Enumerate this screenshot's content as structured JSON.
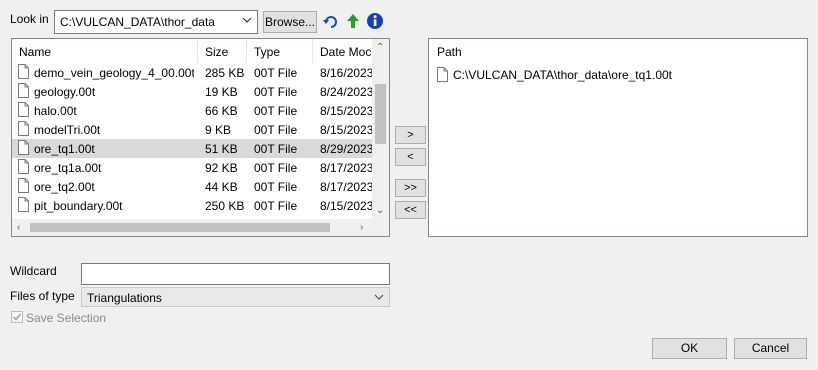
{
  "look_in": {
    "label": "Look in",
    "path": "C:\\VULCAN_DATA\\thor_data",
    "browse_label": "Browse..."
  },
  "icons": {
    "back": "back-arrow-icon",
    "up": "up-folder-icon",
    "info": "info-icon",
    "file": "file-icon",
    "dropdown": "chevron-down-icon"
  },
  "file_list": {
    "columns": [
      "Name",
      "Size",
      "Type",
      "Date Moc"
    ],
    "rows": [
      {
        "name": "demo_vein_geology_4_00.00t",
        "size": "285 KB",
        "type": "00T File",
        "date": "8/16/2023"
      },
      {
        "name": "geology.00t",
        "size": "19 KB",
        "type": "00T File",
        "date": "8/24/2023"
      },
      {
        "name": "halo.00t",
        "size": "66 KB",
        "type": "00T File",
        "date": "8/15/2023"
      },
      {
        "name": "modelTri.00t",
        "size": "9 KB",
        "type": "00T File",
        "date": "8/15/2023"
      },
      {
        "name": "ore_tq1.00t",
        "size": "51 KB",
        "type": "00T File",
        "date": "8/29/2023",
        "selected": true
      },
      {
        "name": "ore_tq1a.00t",
        "size": "92 KB",
        "type": "00T File",
        "date": "8/17/2023"
      },
      {
        "name": "ore_tq2.00t",
        "size": "44 KB",
        "type": "00T File",
        "date": "8/17/2023"
      },
      {
        "name": "pit_boundary.00t",
        "size": "250 KB",
        "type": "00T File",
        "date": "8/15/2023"
      }
    ]
  },
  "move_buttons": {
    "add": ">",
    "remove": "<",
    "add_all": ">>",
    "remove_all": "<<"
  },
  "path_list": {
    "header": "Path",
    "items": [
      "C:\\VULCAN_DATA\\thor_data\\ore_tq1.00t"
    ]
  },
  "wildcard": {
    "label": "Wildcard",
    "value": ""
  },
  "files_of_type": {
    "label": "Files of type",
    "value": "Triangulations"
  },
  "save_selection": {
    "label": "Save Selection",
    "checked": true,
    "enabled": false
  },
  "actions": {
    "ok": "OK",
    "cancel": "Cancel"
  }
}
